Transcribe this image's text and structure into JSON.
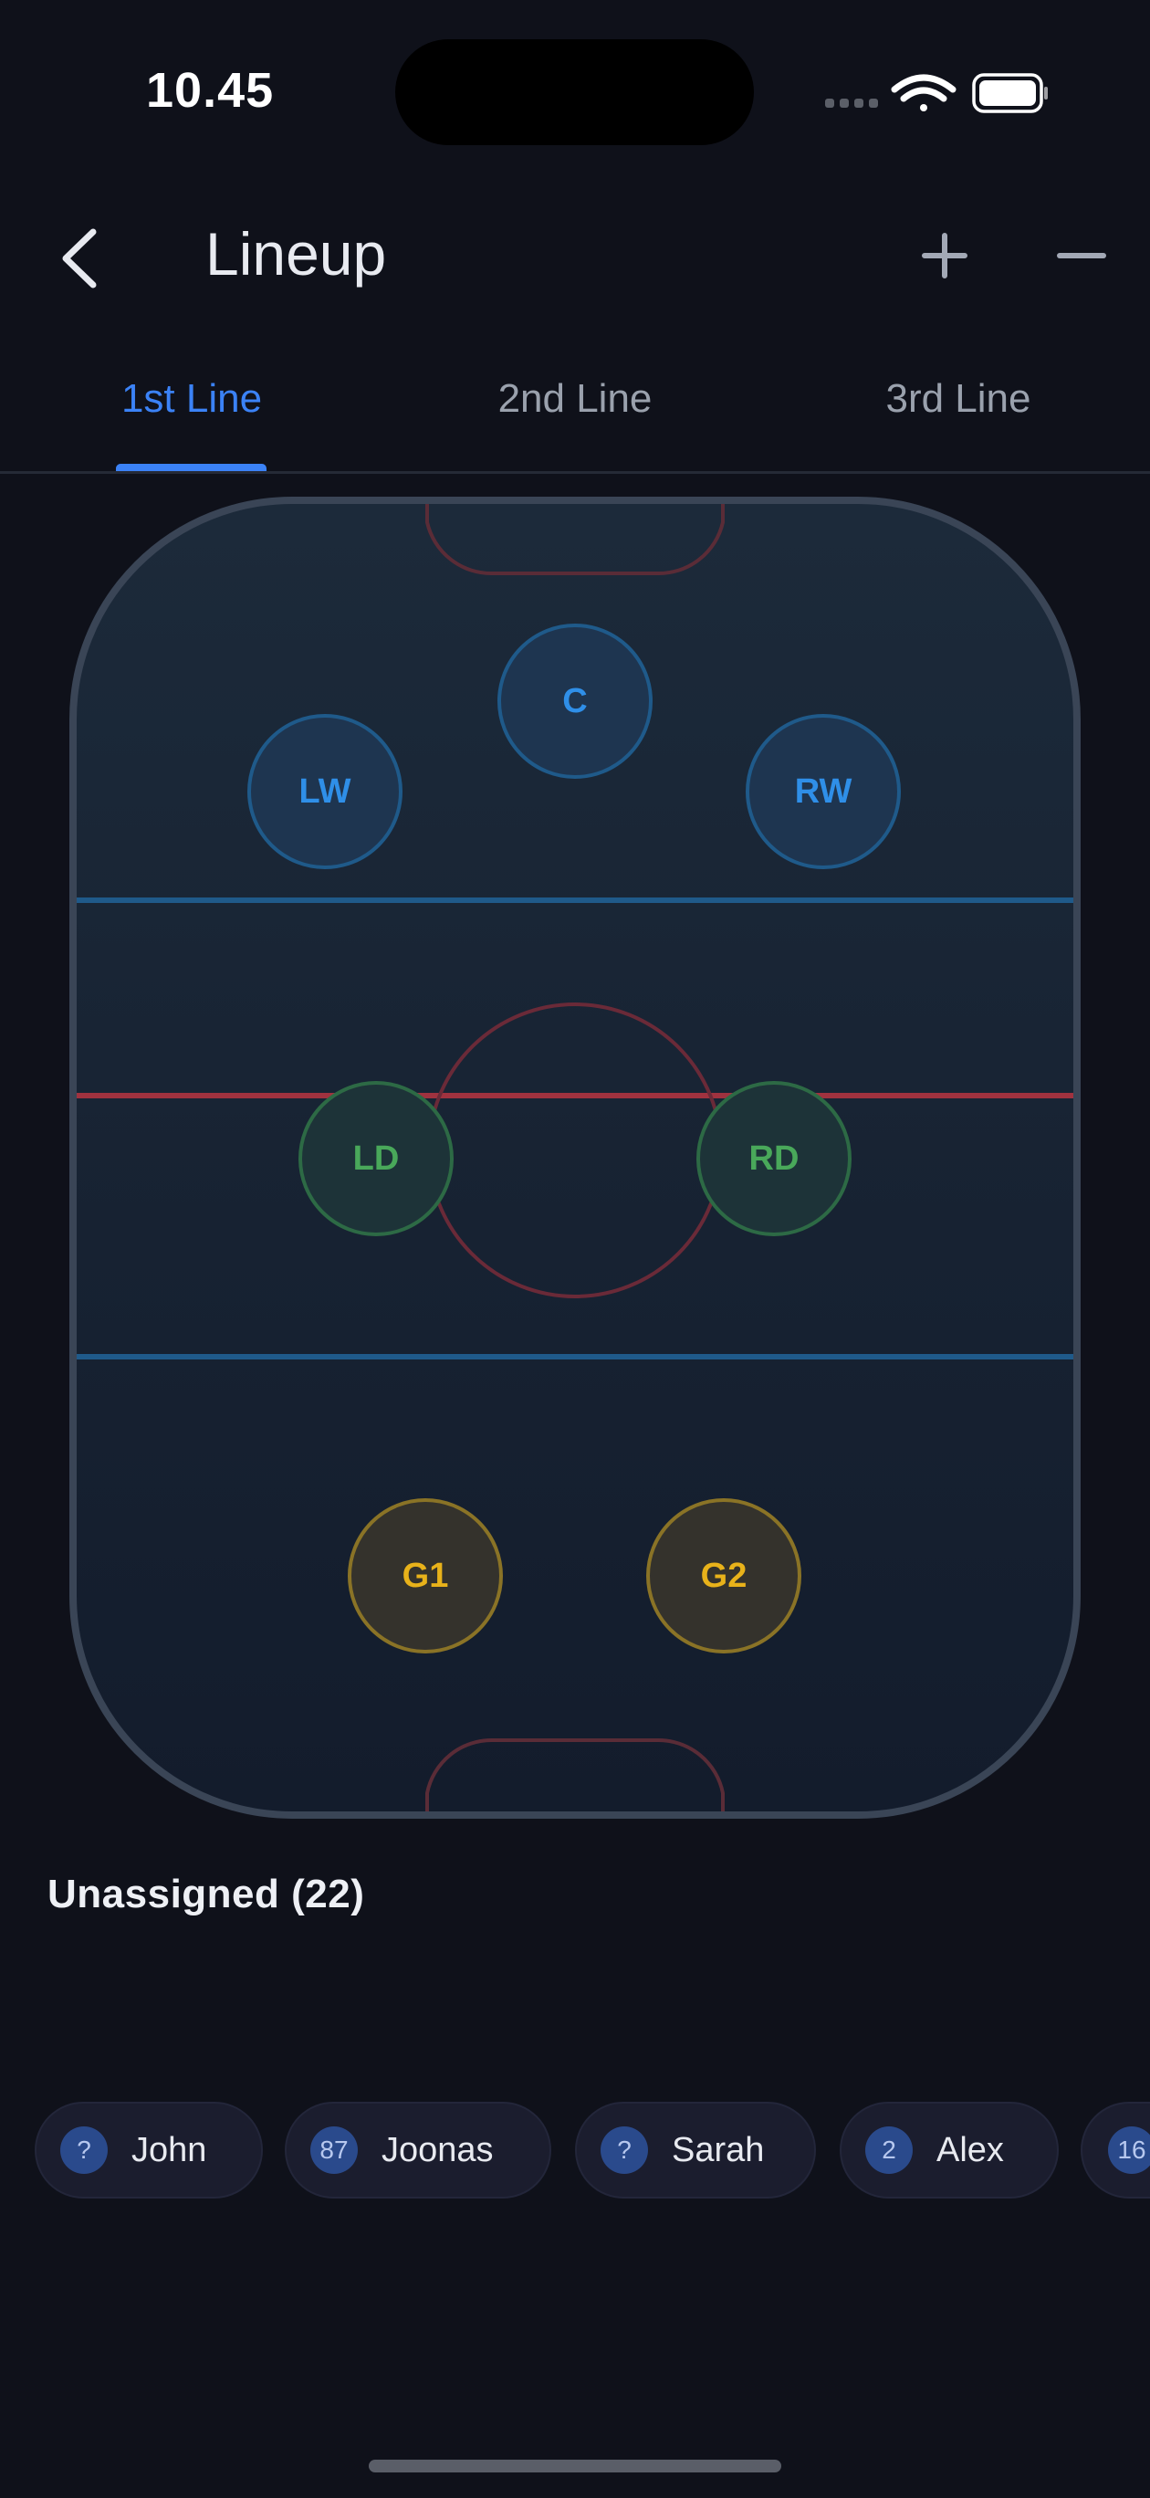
{
  "status_bar": {
    "time": "10.45",
    "icons": [
      "signal-dots-icon",
      "wifi-icon",
      "battery-icon"
    ]
  },
  "header": {
    "title": "Lineup",
    "icons": {
      "back": "chevron-left-icon",
      "add": "plus-icon",
      "remove": "minus-icon"
    }
  },
  "tabs": [
    {
      "label": "1st Line",
      "active": true
    },
    {
      "label": "2nd Line",
      "active": false
    },
    {
      "label": "3rd Line",
      "active": false
    }
  ],
  "positions": {
    "forwards": [
      "LW",
      "C",
      "RW"
    ],
    "defense": [
      "LD",
      "RD"
    ],
    "goalies": [
      "G1",
      "G2"
    ]
  },
  "unassigned": {
    "title": "Unassigned (22)",
    "players": [
      {
        "number": "?",
        "name": "John"
      },
      {
        "number": "87",
        "name": "Joonas"
      },
      {
        "number": "?",
        "name": "Sarah"
      },
      {
        "number": "2",
        "name": "Alex"
      },
      {
        "number": "16",
        "name": ""
      }
    ]
  },
  "colors": {
    "accent": "#3b82f6",
    "forward": "#2f8fe8",
    "defense": "#49a85a",
    "goalie": "#e8b21a",
    "blue_line": "#1f5a8a",
    "red_line": "#a0323f",
    "background": "#0f111a"
  }
}
